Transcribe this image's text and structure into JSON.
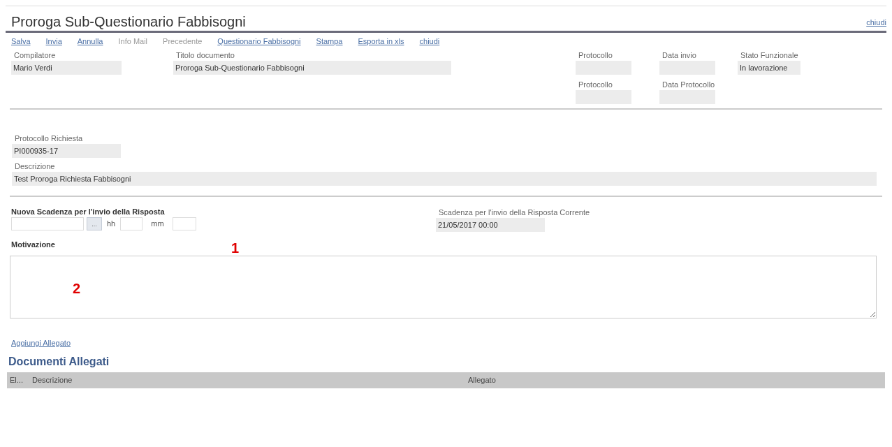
{
  "title": "Proroga Sub-Questionario Fabbisogni",
  "close_link": "chiudi",
  "toolbar": [
    {
      "label": "Salva",
      "disabled": false
    },
    {
      "label": "Invia",
      "disabled": false
    },
    {
      "label": "Annulla",
      "disabled": false
    },
    {
      "label": "Info Mail",
      "disabled": true
    },
    {
      "label": "Precedente",
      "disabled": true
    },
    {
      "label": "Questionario Fabbisogni",
      "disabled": false
    },
    {
      "label": "Stampa",
      "disabled": false
    },
    {
      "label": "Esporta in xls",
      "disabled": false
    },
    {
      "label": "chiudi",
      "disabled": false
    }
  ],
  "header_fields": {
    "compilatore": {
      "label": "Compilatore",
      "value": "Mario Verdi"
    },
    "titolo": {
      "label": "Titolo documento",
      "value": "Proroga Sub-Questionario Fabbisogni"
    },
    "protocollo": {
      "label": "Protocollo"
    },
    "data_invio": {
      "label": "Data invio"
    },
    "protocollo_2": {
      "label": "Protocollo"
    },
    "data_protocollo": {
      "label": "Data Protocollo"
    },
    "stato": {
      "label": "Stato Funzionale",
      "value": "In lavorazione"
    }
  },
  "protocollo_richiesta": {
    "label": "Protocollo Richiesta",
    "value": "PI000935-17"
  },
  "descrizione": {
    "label": "Descrizione",
    "value": "Test Proroga Richiesta Fabbisogni"
  },
  "nuova_scadenza": {
    "label": "Nuova Scadenza per l'invio della Risposta",
    "picker_button": "...",
    "hh_label": "hh",
    "mm_label": "mm"
  },
  "scadenza_corrente": {
    "label": "Scadenza per l'invio della Risposta Corrente",
    "value": "21/05/2017 00:00"
  },
  "motivazione": {
    "label": "Motivazione"
  },
  "callouts": [
    "1",
    "2"
  ],
  "add_attachment": "Aggiungi Allegato",
  "attachments": {
    "title": "Documenti Allegati",
    "columns": [
      "El...",
      "Descrizione",
      "Allegato"
    ]
  }
}
